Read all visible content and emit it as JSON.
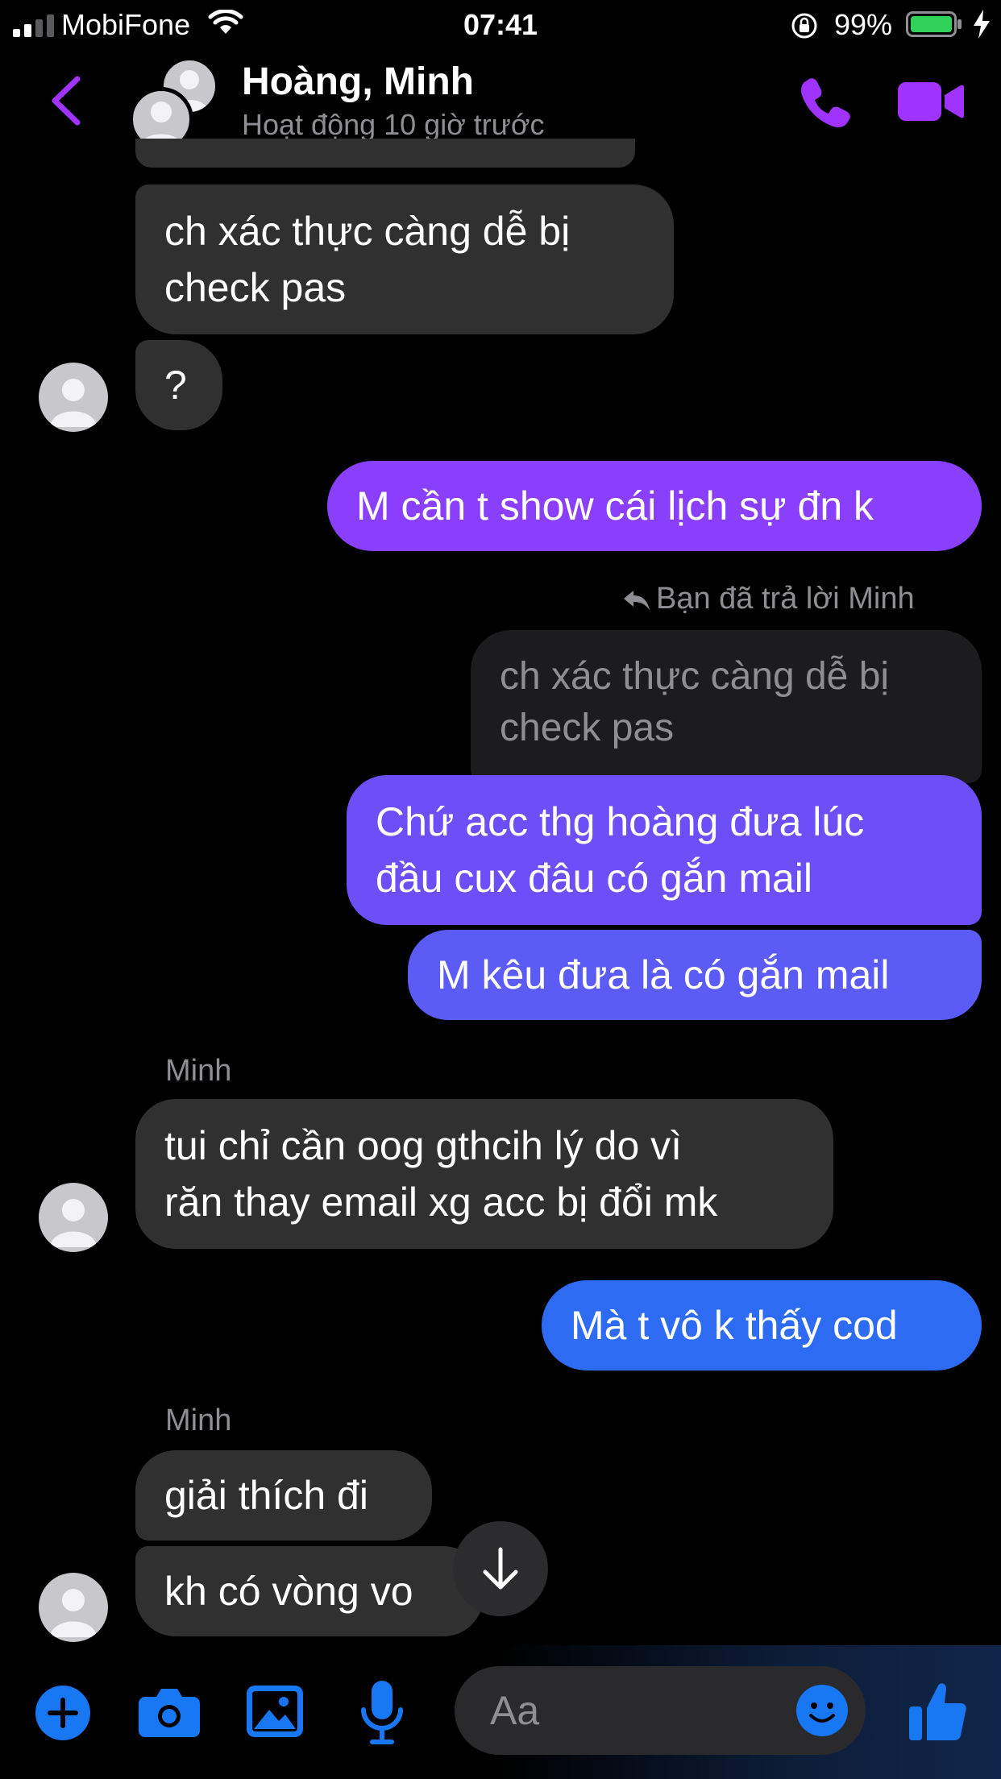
{
  "status_bar": {
    "carrier": "MobiFone",
    "time": "07:41",
    "battery": "99%"
  },
  "header": {
    "name": "Hoàng, Minh",
    "status": "Hoạt động 10 giờ trước"
  },
  "colors": {
    "accent": "#a033ff",
    "composer_blue": "#1877f2",
    "bubble_in": "#303030",
    "bubble_out_top": "#8a3ffc",
    "bubble_out_mid": "#5b5cf5",
    "bubble_out_bottom": "#2d6cf2"
  },
  "messages": [
    {
      "id": "m1",
      "dir": "in",
      "text": "ch xác thực càng dễ bị\ncheck pas"
    },
    {
      "id": "m2",
      "dir": "in",
      "text": "?"
    },
    {
      "id": "m3",
      "dir": "out",
      "text": "M cần t show cái lịch sự đn k"
    },
    {
      "id": "m4",
      "dir": "out",
      "reply_note": "Bạn đã trả lời Minh",
      "quoted": "ch xác thực càng dễ bị\ncheck pas",
      "text": "Chứ acc thg hoàng đưa lúc\nđầu cux đâu có gắn mail"
    },
    {
      "id": "m5",
      "dir": "out",
      "text": "M kêu đưa là có gắn mail"
    },
    {
      "id": "m6",
      "dir": "in",
      "sender": "Minh",
      "text": "tui chỉ cần oog gthcih lý do vì\nrăn thay email xg acc bị đổi mk"
    },
    {
      "id": "m7",
      "dir": "out",
      "text": "Mà t vô k thấy cod"
    },
    {
      "id": "m8",
      "dir": "in",
      "sender": "Minh",
      "text": "giải thích đi"
    },
    {
      "id": "m9",
      "dir": "in",
      "text": "kh có vòng vo"
    }
  ],
  "composer": {
    "placeholder": "Aa",
    "icons": [
      "plus-icon",
      "camera-icon",
      "image-icon",
      "mic-icon",
      "emoji-icon",
      "thumbs-up-icon"
    ]
  }
}
